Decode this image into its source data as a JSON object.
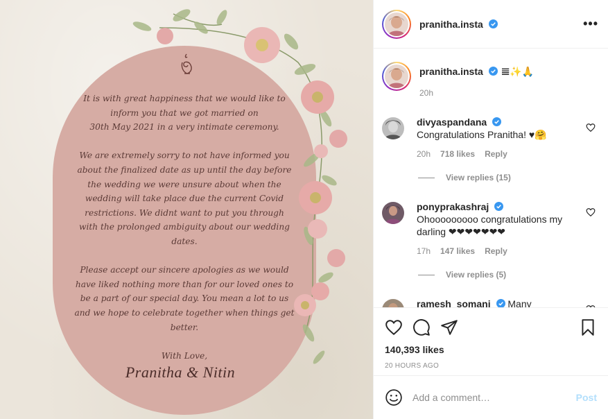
{
  "post": {
    "invite": {
      "paragraphs": [
        "It is with great happiness that we would like to\ninform you that we got married on\n30th May 2021 in a very intimate ceremony.",
        "We are extremely sorry to not have informed you\nabout the finalized date as up until the day before\nthe wedding we were unsure about when the\nwedding will take place due the current Covid\nrestrictions. We didnt want to put you through\nwith the prolonged ambiguity about our wedding\ndates.",
        "Please accept our sincere apologies as we would\nhave liked nothing more than for our loved ones to\nbe a part of our special day. You mean a lot to us\nand we hope to celebrate together when things get\nbetter."
      ],
      "sign_off": "With Love,",
      "signature": "Pranitha & Nitin"
    }
  },
  "header": {
    "username": "pranitha.insta"
  },
  "caption": {
    "username": "pranitha.insta",
    "text": "𝌆✨🙏",
    "time": "20h"
  },
  "comments": [
    {
      "username": "divyaspandana",
      "text": "Congratulations Pranitha! ♥🤗",
      "time": "20h",
      "likes": "718 likes",
      "reply": "Reply",
      "view_replies": "View replies (15)"
    },
    {
      "username": "ponyprakashraj",
      "text": "Ohooooooooo congratulations my darling ❤❤❤❤❤❤❤",
      "time": "17h",
      "likes": "147 likes",
      "reply": "Reply",
      "view_replies": "View replies (5)"
    },
    {
      "username": "ramesh_somani",
      "text": "Many"
    }
  ],
  "actions": {
    "likes": "140,393 likes",
    "ago": "20 HOURS AGO"
  },
  "add_comment": {
    "placeholder": "Add a comment…",
    "post_label": "Post"
  },
  "colors": {
    "verified": "#3897f0",
    "accent_post": "#b2dffc",
    "secondary_text": "#8e8e8e"
  }
}
